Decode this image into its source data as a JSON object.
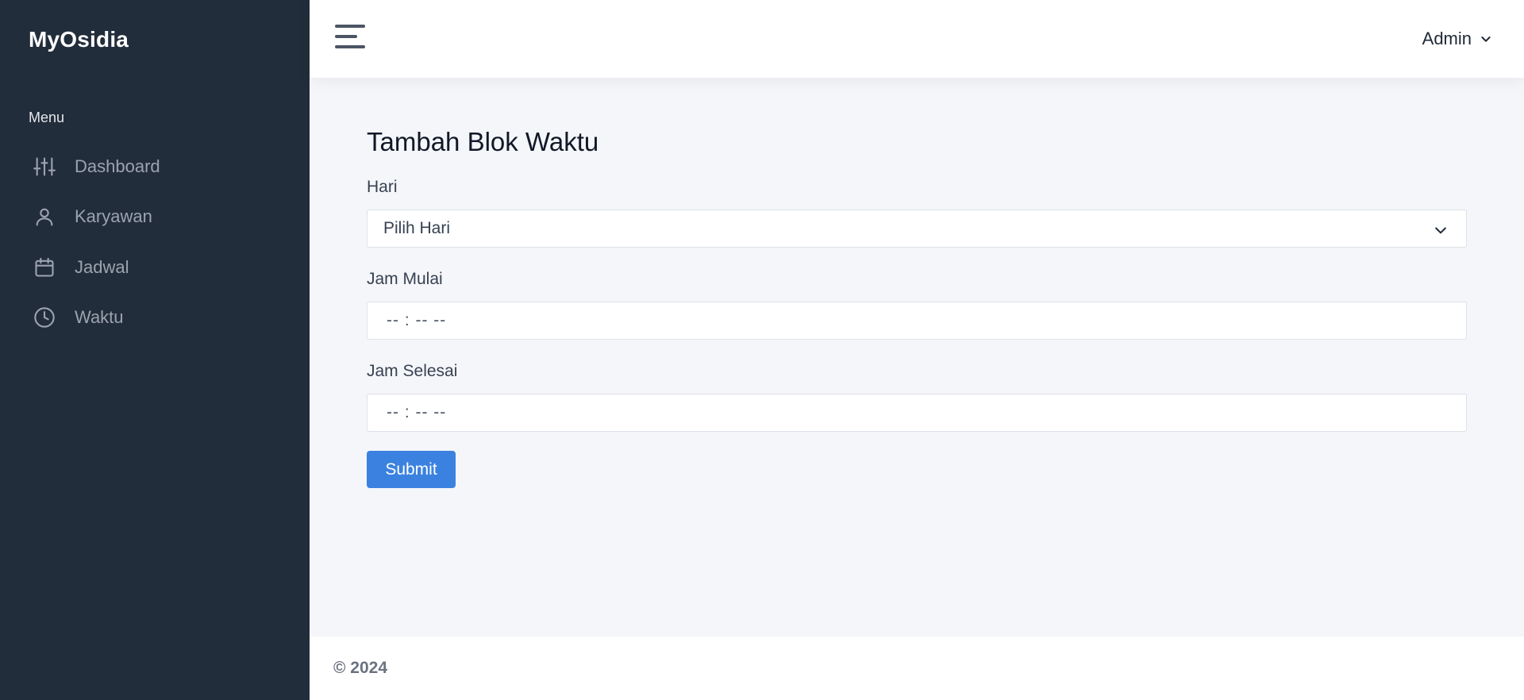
{
  "sidebar": {
    "brand": "MyOsidia",
    "menu_heading": "Menu",
    "items": [
      {
        "label": "Dashboard",
        "icon": "sliders-icon"
      },
      {
        "label": "Karyawan",
        "icon": "user-icon"
      },
      {
        "label": "Jadwal",
        "icon": "calendar-icon"
      },
      {
        "label": "Waktu",
        "icon": "clock-icon"
      }
    ]
  },
  "header": {
    "user_label": "Admin"
  },
  "form": {
    "title": "Tambah Blok Waktu",
    "day": {
      "label": "Hari",
      "selected": "Pilih Hari"
    },
    "start_time": {
      "label": "Jam Mulai",
      "value": "-- : --  --"
    },
    "end_time": {
      "label": "Jam Selesai",
      "value": "-- : --  --"
    },
    "submit_label": "Submit"
  },
  "footer": {
    "text": "© 2024"
  },
  "colors": {
    "sidebar_bg": "#222d3b",
    "accent": "#3b82e0",
    "page_bg": "#f5f6fa"
  }
}
